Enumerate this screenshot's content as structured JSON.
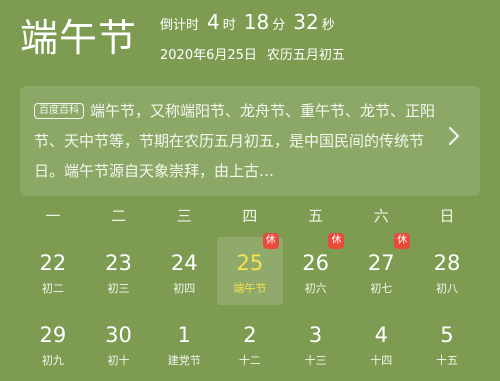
{
  "header": {
    "title": "端午节",
    "countdown_label": "倒计时",
    "countdown": [
      {
        "value": "4",
        "unit": "时"
      },
      {
        "value": "18",
        "unit": "分"
      },
      {
        "value": "32",
        "unit": "秒"
      }
    ],
    "date": "2020年6月25日",
    "lunar_date": "农历五月初五"
  },
  "info": {
    "badge": "百度百科",
    "text": "端午节，又称端阳节、龙舟节、重午节、龙节、正阳节、天中节等，节期在农历五月初五，是中国民间的传统节日。端午节源自天象崇拜，由上古…",
    "chevron_icon": "chevron-right-icon"
  },
  "calendar": {
    "weekdays": [
      "一",
      "二",
      "三",
      "四",
      "五",
      "六",
      "日"
    ],
    "rows": [
      [
        {
          "day": "22",
          "lunar": "初二"
        },
        {
          "day": "23",
          "lunar": "初三"
        },
        {
          "day": "24",
          "lunar": "初四"
        },
        {
          "day": "25",
          "lunar": "端午节",
          "today": true,
          "rest": "休"
        },
        {
          "day": "26",
          "lunar": "初六",
          "rest": "休"
        },
        {
          "day": "27",
          "lunar": "初七",
          "rest": "休"
        },
        {
          "day": "28",
          "lunar": "初八"
        }
      ],
      [
        {
          "day": "29",
          "lunar": "初九"
        },
        {
          "day": "30",
          "lunar": "初十"
        },
        {
          "day": "1",
          "lunar": "建党节"
        },
        {
          "day": "2",
          "lunar": "十二"
        },
        {
          "day": "3",
          "lunar": "十三"
        },
        {
          "day": "4",
          "lunar": "十四"
        },
        {
          "day": "5",
          "lunar": "十五"
        }
      ]
    ]
  },
  "colors": {
    "background": "#7d9c52",
    "highlight": "#f6e24c",
    "rest_badge": "#e84b3c"
  }
}
